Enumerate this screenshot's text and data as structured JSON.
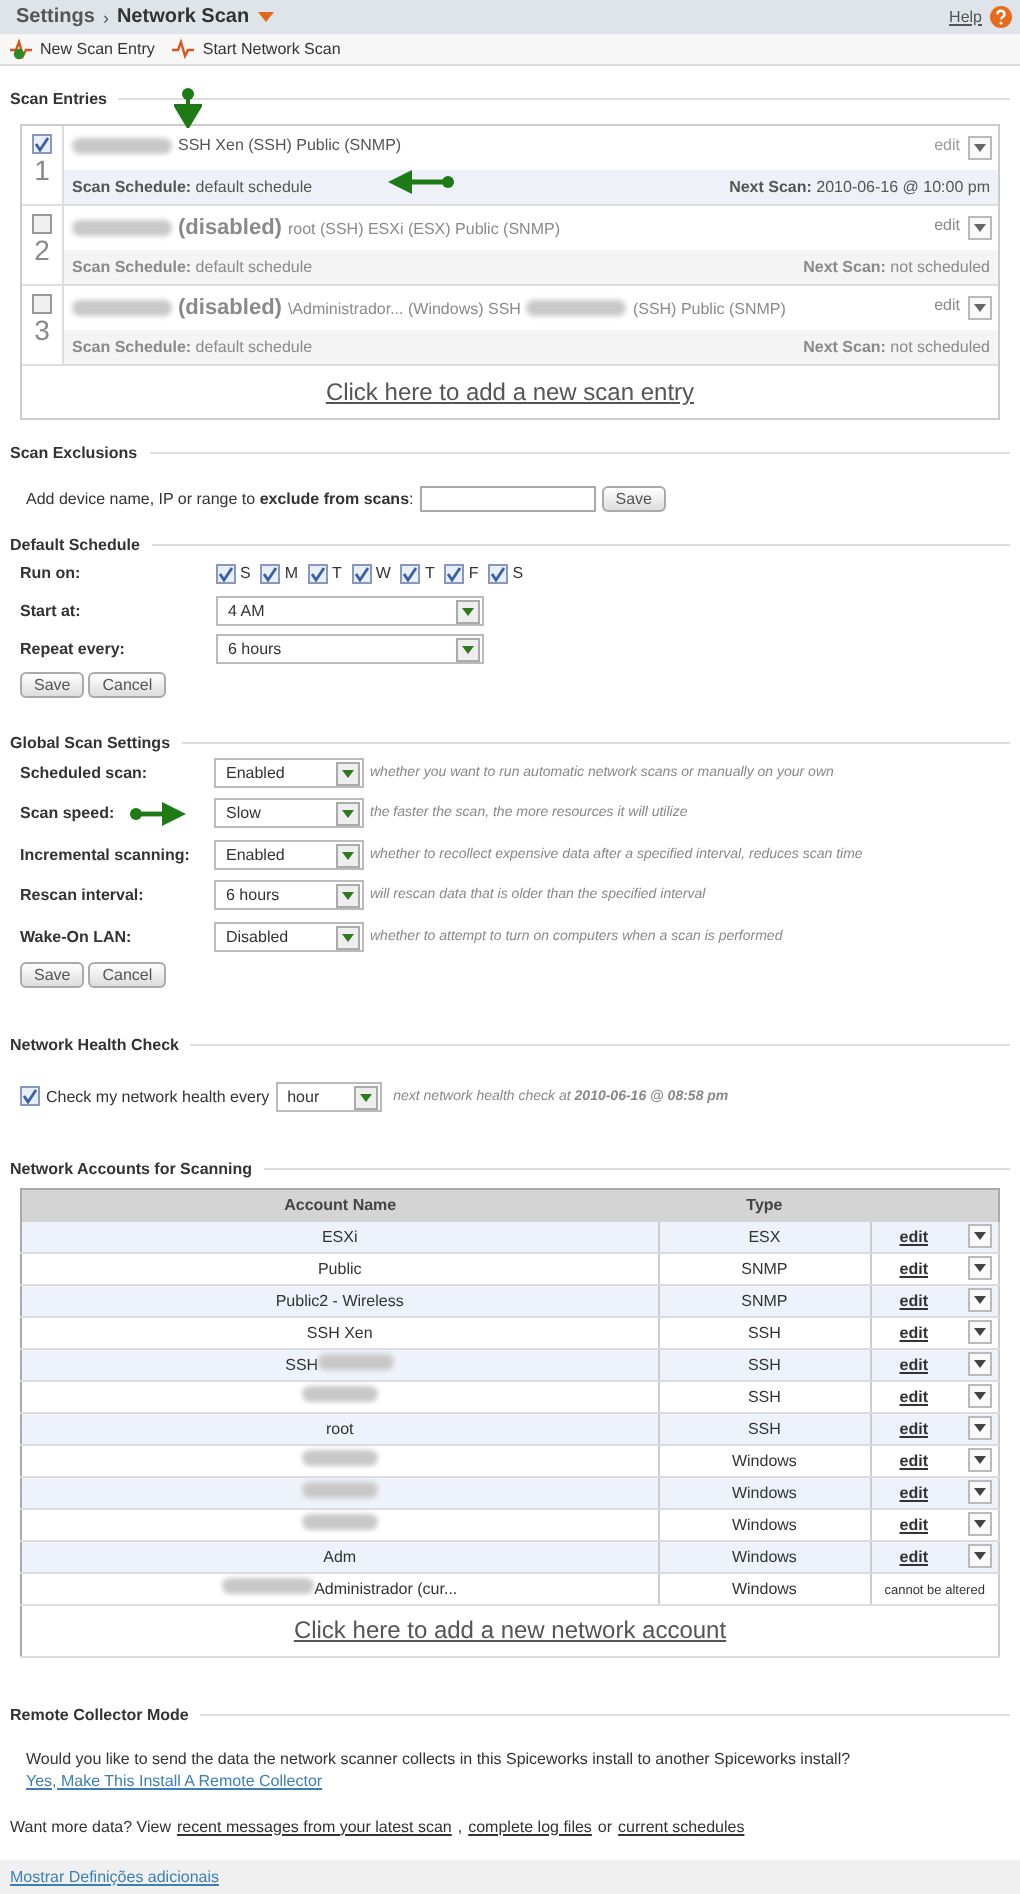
{
  "header": {
    "crumb": "Settings",
    "separator": "›",
    "title": "Network Scan",
    "help": "Help"
  },
  "toolbar": [
    "New Scan Entry",
    "Start Network Scan"
  ],
  "scan_entries": {
    "heading": "Scan Entries",
    "entries": [
      {
        "number": "1",
        "checked": true,
        "disabled": false,
        "parts": [
          {
            "kind": "blur"
          },
          {
            "kind": "text",
            "text": "SSH Xen (SSH) Public (SNMP)"
          }
        ],
        "edit": "edit",
        "schedule_label": "Scan Schedule:",
        "schedule": "default schedule",
        "next_label": "Next Scan:",
        "next": "2010-06-16 @ 10:00 pm"
      },
      {
        "number": "2",
        "checked": false,
        "disabled": true,
        "status": "(disabled)",
        "parts": [
          {
            "kind": "blur"
          },
          {
            "kind": "text",
            "text": "root (SSH) ESXi (ESX) Public (SNMP)"
          }
        ],
        "edit": "edit",
        "schedule_label": "Scan Schedule:",
        "schedule": "default schedule",
        "next_label": "Next Scan:",
        "next": "not scheduled"
      },
      {
        "number": "3",
        "checked": false,
        "disabled": true,
        "status": "(disabled)",
        "parts": [
          {
            "kind": "blur"
          },
          {
            "kind": "text",
            "text": "\\Administrador... (Windows) SSH"
          },
          {
            "kind": "blur"
          },
          {
            "kind": "text",
            "text": "(SSH) Public (SNMP)"
          }
        ],
        "edit": "edit",
        "schedule_label": "Scan Schedule:",
        "schedule": "default schedule",
        "next_label": "Next Scan:",
        "next": "not scheduled"
      }
    ],
    "add_link": "Click here to add a new scan entry"
  },
  "scan_exclusions": {
    "heading": "Scan Exclusions",
    "prompt": "Add device name, IP or range to **exclude from scans**:",
    "button": "Save"
  },
  "default_schedule": {
    "heading": "Default Schedule",
    "run_on_label": "Run on:",
    "days": [
      {
        "label": "S",
        "checked": true
      },
      {
        "label": "M",
        "checked": true
      },
      {
        "label": "T",
        "checked": true
      },
      {
        "label": "W",
        "checked": true
      },
      {
        "label": "T",
        "checked": true
      },
      {
        "label": "F",
        "checked": true
      },
      {
        "label": "S",
        "checked": true
      }
    ],
    "rows": [
      {
        "label": "Start at:",
        "value": "4 AM"
      },
      {
        "label": "Repeat every:",
        "value": "6 hours"
      }
    ],
    "buttons": [
      "Save",
      "Cancel"
    ]
  },
  "global_scan_settings": {
    "heading": "Global Scan Settings",
    "rows": [
      {
        "label": "Scheduled scan:",
        "value": "Enabled",
        "hint": "whether you want to run automatic network scans or manually on your own"
      },
      {
        "label": "Scan speed:",
        "value": "Slow",
        "hint": "the faster the scan, the more resources it will utilize"
      },
      {
        "label": "Incremental scanning:",
        "value": "Enabled",
        "hint": "whether to recollect expensive data after a specified interval, reduces scan time"
      },
      {
        "label": "Rescan interval:",
        "value": "6 hours",
        "hint": "will rescan data that is older than the specified interval"
      },
      {
        "label": "Wake-On LAN:",
        "value": "Disabled",
        "hint": "whether to attempt to turn on computers when a scan is performed"
      }
    ],
    "buttons": [
      "Save",
      "Cancel"
    ]
  },
  "network_health_check": {
    "heading": "Network Health Check",
    "checked": true,
    "label": "Check my network health every",
    "value": "hour",
    "note": "next network health check at **2010-06-16 @ 08:58 pm**"
  },
  "network_accounts": {
    "heading": "Network Accounts for Scanning",
    "columns": [
      "Account Name",
      "Type"
    ],
    "rows": [
      {
        "name": "ESXi",
        "type": "ESX",
        "action": "edit"
      },
      {
        "name": "Public",
        "type": "SNMP",
        "action": "edit"
      },
      {
        "name": "Public2 - Wireless",
        "type": "SNMP",
        "action": "edit"
      },
      {
        "name": "SSH Xen",
        "type": "SSH",
        "action": "edit"
      },
      {
        "name": "SSH",
        "blur_after": true,
        "type": "SSH",
        "action": "edit"
      },
      {
        "blurred": true,
        "type": "SSH",
        "action": "edit"
      },
      {
        "name": "root",
        "type": "SSH",
        "action": "edit"
      },
      {
        "blurred": true,
        "type": "Windows",
        "action": "edit"
      },
      {
        "blurred": true,
        "type": "Windows",
        "action": "edit"
      },
      {
        "blurred": true,
        "type": "Windows",
        "action": "edit"
      },
      {
        "name": "Adm",
        "type": "Windows",
        "action": "edit"
      },
      {
        "name": "Administrador (cur...",
        "blur_before": true,
        "type": "Windows",
        "note": "cannot be altered"
      }
    ],
    "add_link": "Click here to add a new network account"
  },
  "remote_collector": {
    "heading": "Remote Collector Mode",
    "question": "Would you like to send the data the network scanner collects in this Spiceworks install to another Spiceworks install?",
    "link": "Yes, Make This Install A Remote Collector"
  },
  "more_data": {
    "lead": "Want more data? View",
    "links": [
      "recent messages from your latest scan",
      "complete log files",
      "current schedules"
    ],
    "separators": [
      ",",
      "or"
    ]
  },
  "footer_link": "Mostrar Definições adicionais"
}
